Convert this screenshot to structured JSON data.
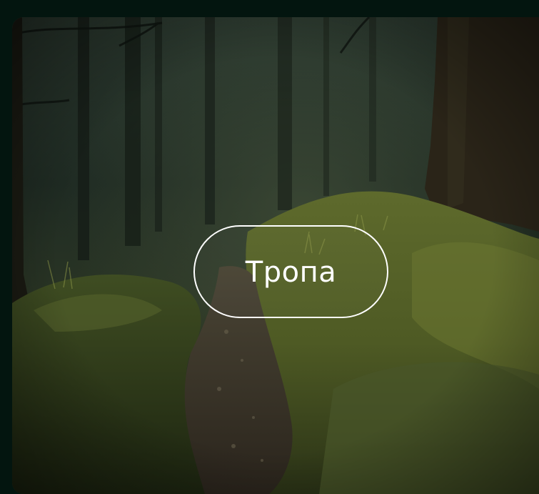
{
  "card": {
    "image": "forest-trail-photo",
    "label": "Тропа"
  },
  "colors": {
    "page_background": "#03150f",
    "label_border": "#ffffff",
    "label_text": "#ffffff"
  }
}
